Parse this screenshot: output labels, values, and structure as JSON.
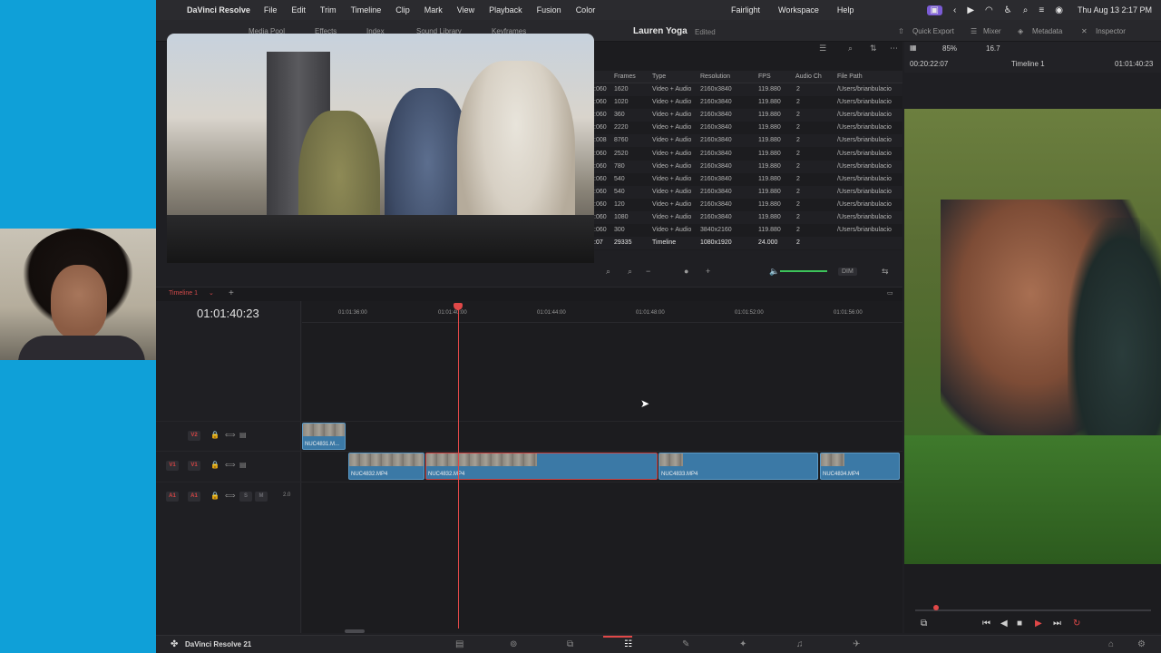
{
  "menubar": {
    "app_name": "DaVinci Resolve",
    "items": [
      "File",
      "Edit",
      "Trim",
      "Timeline",
      "Clip",
      "Mark",
      "View",
      "Playback",
      "Fusion",
      "Color"
    ],
    "center_items": [
      "Fairlight",
      "Workspace",
      "Help"
    ],
    "clock": "Thu Aug 13  2:17 PM"
  },
  "toolbar": {
    "media_pool": "Media Pool",
    "effects": "Effects",
    "index": "Index",
    "sound_library": "Sound Library",
    "keyframes": "Keyframes",
    "project_title": "Lauren Yoga",
    "project_status": "Edited",
    "quick_export": "Quick Export",
    "mixer": "Mixer",
    "metadata": "Metadata",
    "inspector": "Inspector"
  },
  "bin": {
    "columns": [
      "Frames",
      "Type",
      "Resolution",
      "FPS",
      "Audio Ch",
      "File Path"
    ],
    "rows": [
      {
        "tc": ":060",
        "frames": "1620",
        "type": "Video + Audio",
        "res": "2160x3840",
        "fps": "119.880",
        "audio": "2",
        "path": "/Users/brianbulacio"
      },
      {
        "tc": ":060",
        "frames": "1020",
        "type": "Video + Audio",
        "res": "2160x3840",
        "fps": "119.880",
        "audio": "2",
        "path": "/Users/brianbulacio"
      },
      {
        "tc": ":060",
        "frames": "360",
        "type": "Video + Audio",
        "res": "2160x3840",
        "fps": "119.880",
        "audio": "2",
        "path": "/Users/brianbulacio"
      },
      {
        "tc": ":060",
        "frames": "2220",
        "type": "Video + Audio",
        "res": "2160x3840",
        "fps": "119.880",
        "audio": "2",
        "path": "/Users/brianbulacio"
      },
      {
        "tc": ":008",
        "frames": "8760",
        "type": "Video + Audio",
        "res": "2160x3840",
        "fps": "119.880",
        "audio": "2",
        "path": "/Users/brianbulacio"
      },
      {
        "tc": ":060",
        "frames": "2520",
        "type": "Video + Audio",
        "res": "2160x3840",
        "fps": "119.880",
        "audio": "2",
        "path": "/Users/brianbulacio"
      },
      {
        "tc": ":060",
        "frames": "780",
        "type": "Video + Audio",
        "res": "2160x3840",
        "fps": "119.880",
        "audio": "2",
        "path": "/Users/brianbulacio"
      },
      {
        "tc": ":060",
        "frames": "540",
        "type": "Video + Audio",
        "res": "2160x3840",
        "fps": "119.880",
        "audio": "2",
        "path": "/Users/brianbulacio"
      },
      {
        "tc": ":060",
        "frames": "540",
        "type": "Video + Audio",
        "res": "2160x3840",
        "fps": "119.880",
        "audio": "2",
        "path": "/Users/brianbulacio"
      },
      {
        "tc": ":060",
        "frames": "120",
        "type": "Video + Audio",
        "res": "2160x3840",
        "fps": "119.880",
        "audio": "2",
        "path": "/Users/brianbulacio"
      },
      {
        "tc": ":060",
        "frames": "1080",
        "type": "Video + Audio",
        "res": "2160x3840",
        "fps": "119.880",
        "audio": "2",
        "path": "/Users/brianbulacio"
      },
      {
        "tc": ":060",
        "frames": "300",
        "type": "Video + Audio",
        "res": "3840x2160",
        "fps": "119.880",
        "audio": "2",
        "path": "/Users/brianbulacio"
      },
      {
        "tc": ":07",
        "frames": "29335",
        "type": "Timeline",
        "res": "1080x1920",
        "fps": "24.000",
        "audio": "2",
        "path": ""
      }
    ]
  },
  "viewer": {
    "zoom": "85%",
    "rate": "16.7",
    "timecode_left": "00:20:22:07",
    "timeline_name": "Timeline 1",
    "timecode_right": "01:01:40:23"
  },
  "timeline": {
    "tab_label": "Timeline 1",
    "timecode": "01:01:40:23",
    "dim_label": "DIM",
    "ruler": [
      "01:01:36:00",
      "01:01:40:00",
      "01:01:44:00",
      "01:01:48:00",
      "01:01:52:00",
      "01:01:56:00"
    ],
    "tracks": {
      "v2_label": "V2",
      "v1_label": "V1",
      "v1_source": "V1",
      "a1_label": "A1",
      "a1_source": "A1",
      "a1_level": "2.0"
    },
    "clips": {
      "v2_clip": "NUC4831.M...",
      "v1_clip1": "NUC4832.MP4",
      "v1_clip2": "NUC4832.MP4",
      "v1_clip3": "NUC4833.MP4",
      "v1_clip4": "NUC4834.MP4"
    }
  },
  "pagebar": {
    "app_version": "DaVinci Resolve 21"
  },
  "colors": {
    "accent_red": "#e04848",
    "clip_blue": "#3b79a6",
    "audio_green": "#3cc35a"
  }
}
